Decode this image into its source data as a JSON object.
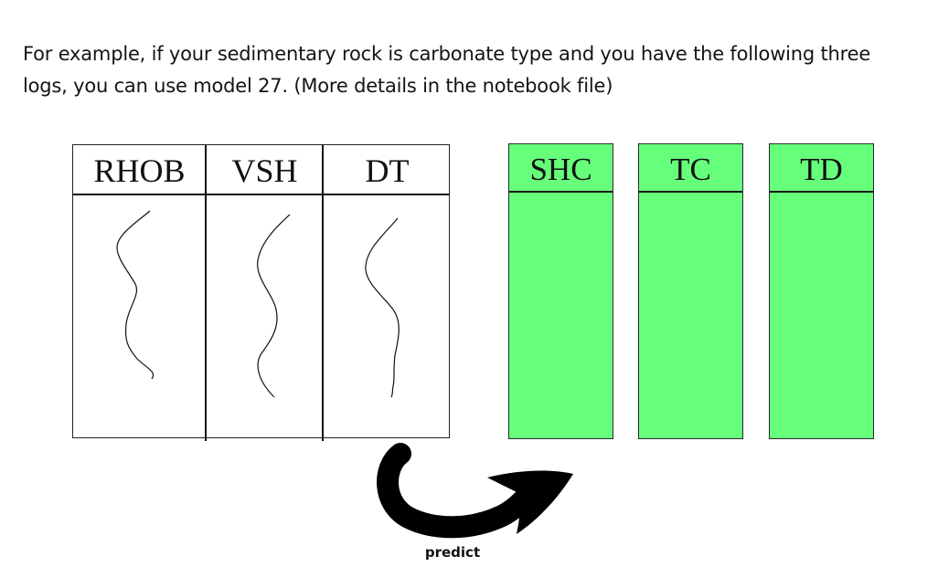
{
  "intro": {
    "line1": "For example, if your sedimentary rock is carbonate type and you have the following three",
    "line2": "logs, you can use model 27. (More details in the notebook file)"
  },
  "input_logs": {
    "columns": [
      "RHOB",
      "VSH",
      "DT"
    ]
  },
  "output_logs": {
    "columns": [
      "SHC",
      "TC",
      "TD"
    ],
    "fill_color": "#66ff7c"
  },
  "arrow": {
    "label": "predict",
    "color": "#000000",
    "icon": "curved-arrow-icon"
  }
}
